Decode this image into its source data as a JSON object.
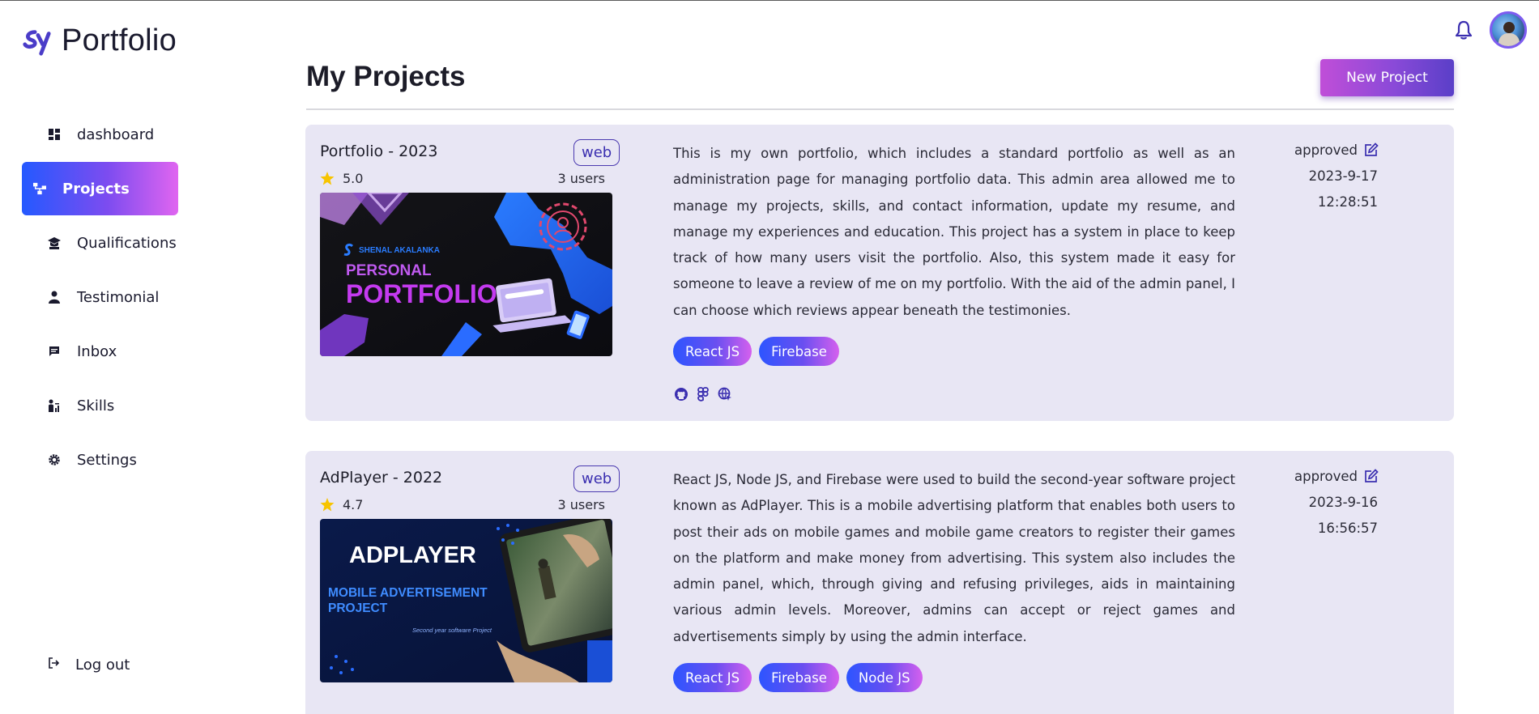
{
  "app": {
    "title": "Portfolio"
  },
  "sidebar": {
    "items": [
      {
        "label": "dashboard",
        "icon": "dashboard-icon"
      },
      {
        "label": "Projects",
        "icon": "projects-icon",
        "active": true
      },
      {
        "label": "Qualifications",
        "icon": "graduation-icon"
      },
      {
        "label": "Testimonial",
        "icon": "user-icon"
      },
      {
        "label": "Inbox",
        "icon": "chat-icon"
      },
      {
        "label": "Skills",
        "icon": "skills-icon"
      },
      {
        "label": "Settings",
        "icon": "gear-icon"
      }
    ],
    "logout_label": "Log out"
  },
  "header": {
    "title": "My Projects",
    "new_button": "New Project"
  },
  "colors": {
    "accent": "#7d4cf0",
    "card_bg": "#e8e6f4",
    "badge": "#3b2fb0"
  },
  "projects": [
    {
      "title": "Portfolio - 2023",
      "badge": "web",
      "rating": "5.0",
      "users": "3 users",
      "thumb": {
        "brand": "SHENAL AKALANKA",
        "line1": "PERSONAL",
        "line2": "PORTFOLIO"
      },
      "description": "This is my own portfolio, which includes a standard portfolio as well as an administration page for managing portfolio data. This admin area allowed me to manage my projects, skills, and contact information, update my resume, and manage my experiences and education. This project has a system in place to keep track of how many users visit the portfolio. Also, this system made it easy for someone to leave a review of me on my portfolio. With the aid of the admin panel, I can choose which reviews appear beneath the testimonies.",
      "tags": [
        "React JS",
        "Firebase"
      ],
      "status": "approved",
      "date": "2023-9-17",
      "time": "12:28:51"
    },
    {
      "title": "AdPlayer - 2022",
      "badge": "web",
      "rating": "4.7",
      "users": "3 users",
      "thumb": {
        "line1": "ADPLAYER",
        "line2": "MOBILE ADVERTISEMENT",
        "line3": "PROJECT",
        "caption": "Second year software Project"
      },
      "description": "React JS, Node JS, and Firebase were used to build the second-year software project known as AdPlayer. This is a mobile advertising platform that enables both users to post their ads on mobile games and mobile game creators to register their games on the platform and make money from advertising. This system also includes the admin panel, which, through giving and refusing privileges, aids in maintaining various admin levels. Moreover, admins can accept or reject games and advertisements simply by using the admin interface.",
      "tags": [
        "React JS",
        "Firebase",
        "Node JS"
      ],
      "status": "approved",
      "date": "2023-9-16",
      "time": "16:56:57"
    }
  ]
}
